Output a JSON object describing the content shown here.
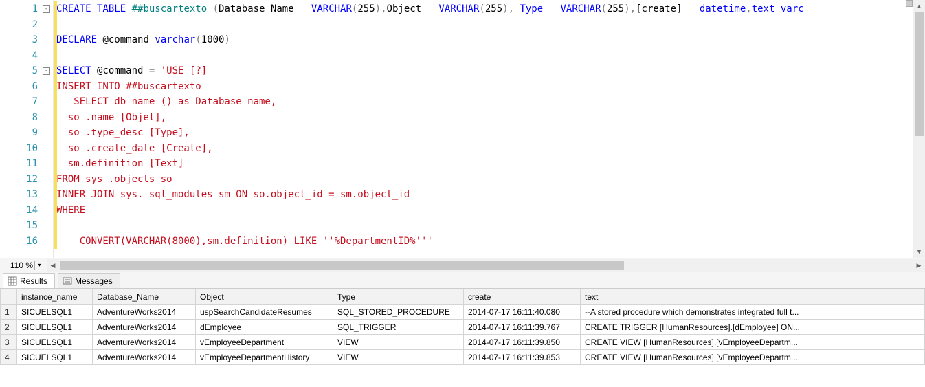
{
  "editor": {
    "zoom": "110 %",
    "lines": [
      {
        "num": 1,
        "fold": "-",
        "tokens": [
          {
            "t": "CREATE TABLE",
            "c": "tok-blue"
          },
          {
            "t": " ",
            "c": ""
          },
          {
            "t": "##buscartexto",
            "c": "tok-teal"
          },
          {
            "t": " ",
            "c": ""
          },
          {
            "t": "(",
            "c": "tok-gray"
          },
          {
            "t": "Database_Name   ",
            "c": "tok-black"
          },
          {
            "t": "VARCHAR",
            "c": "tok-blue"
          },
          {
            "t": "(",
            "c": "tok-gray"
          },
          {
            "t": "255",
            "c": "tok-black"
          },
          {
            "t": ")",
            "c": "tok-gray"
          },
          {
            "t": ",",
            "c": "tok-gray"
          },
          {
            "t": "Object   ",
            "c": "tok-black"
          },
          {
            "t": "VARCHAR",
            "c": "tok-blue"
          },
          {
            "t": "(",
            "c": "tok-gray"
          },
          {
            "t": "255",
            "c": "tok-black"
          },
          {
            "t": ")",
            "c": "tok-gray"
          },
          {
            "t": ",",
            "c": "tok-gray"
          },
          {
            "t": " ",
            "c": ""
          },
          {
            "t": "Type",
            "c": "tok-blue"
          },
          {
            "t": "   ",
            "c": ""
          },
          {
            "t": "VARCHAR",
            "c": "tok-blue"
          },
          {
            "t": "(",
            "c": "tok-gray"
          },
          {
            "t": "255",
            "c": "tok-black"
          },
          {
            "t": ")",
            "c": "tok-gray"
          },
          {
            "t": ",",
            "c": "tok-gray"
          },
          {
            "t": "[create]   ",
            "c": "tok-black"
          },
          {
            "t": "datetime",
            "c": "tok-blue"
          },
          {
            "t": ",",
            "c": "tok-gray"
          },
          {
            "t": "text",
            "c": "tok-blue"
          },
          {
            "t": " ",
            "c": ""
          },
          {
            "t": "varc",
            "c": "tok-blue"
          }
        ]
      },
      {
        "num": 2,
        "tokens": []
      },
      {
        "num": 3,
        "tokens": [
          {
            "t": "DECLARE",
            "c": "tok-blue"
          },
          {
            "t": " @command ",
            "c": "tok-black"
          },
          {
            "t": "varchar",
            "c": "tok-blue"
          },
          {
            "t": "(",
            "c": "tok-gray"
          },
          {
            "t": "1000",
            "c": "tok-black"
          },
          {
            "t": ")",
            "c": "tok-gray"
          }
        ]
      },
      {
        "num": 4,
        "tokens": []
      },
      {
        "num": 5,
        "fold": "-",
        "tokens": [
          {
            "t": "SELECT",
            "c": "tok-blue"
          },
          {
            "t": " @command ",
            "c": "tok-black"
          },
          {
            "t": "=",
            "c": "tok-gray"
          },
          {
            "t": " ",
            "c": ""
          },
          {
            "t": "'USE [?]",
            "c": "tok-red"
          }
        ]
      },
      {
        "num": 6,
        "tokens": [
          {
            "t": "INSERT INTO ##buscartexto",
            "c": "tok-red"
          }
        ]
      },
      {
        "num": 7,
        "tokens": [
          {
            "t": "   SELECT db_name () as Database_name,",
            "c": "tok-red"
          }
        ]
      },
      {
        "num": 8,
        "tokens": [
          {
            "t": "  so .name [Objet],",
            "c": "tok-red"
          }
        ]
      },
      {
        "num": 9,
        "tokens": [
          {
            "t": "  so .type_desc [Type],",
            "c": "tok-red"
          }
        ]
      },
      {
        "num": 10,
        "tokens": [
          {
            "t": "  so .create_date [Create],",
            "c": "tok-red"
          }
        ]
      },
      {
        "num": 11,
        "tokens": [
          {
            "t": "  sm.definition [Text]",
            "c": "tok-red"
          }
        ]
      },
      {
        "num": 12,
        "tokens": [
          {
            "t": "FROM sys .objects so",
            "c": "tok-red"
          }
        ]
      },
      {
        "num": 13,
        "tokens": [
          {
            "t": "INNER JOIN sys. sql_modules sm ON so.object_id = sm.object_id",
            "c": "tok-red"
          }
        ]
      },
      {
        "num": 14,
        "tokens": [
          {
            "t": "WHERE",
            "c": "tok-red"
          }
        ]
      },
      {
        "num": 15,
        "tokens": []
      },
      {
        "num": 16,
        "tokens": [
          {
            "t": "    CONVERT(VARCHAR(8000),sm.definition) LIKE ''%DepartmentID%'''",
            "c": "tok-red"
          }
        ]
      }
    ]
  },
  "tabs": {
    "results": "Results",
    "messages": "Messages"
  },
  "grid": {
    "headers": {
      "row": "",
      "instance": "instance_name",
      "database": "Database_Name",
      "object": "Object",
      "type": "Type",
      "create": "create",
      "text": "text"
    },
    "rows": [
      {
        "n": "1",
        "instance": "SICUELSQL1",
        "database": "AdventureWorks2014",
        "object": "uspSearchCandidateResumes",
        "type": "SQL_STORED_PROCEDURE",
        "create": "2014-07-17 16:11:40.080",
        "text": "--A stored procedure which demonstrates integrated full t..."
      },
      {
        "n": "2",
        "instance": "SICUELSQL1",
        "database": "AdventureWorks2014",
        "object": "dEmployee",
        "type": "SQL_TRIGGER",
        "create": "2014-07-17 16:11:39.767",
        "text": "CREATE TRIGGER [HumanResources].[dEmployee] ON..."
      },
      {
        "n": "3",
        "instance": "SICUELSQL1",
        "database": "AdventureWorks2014",
        "object": "vEmployeeDepartment",
        "type": "VIEW",
        "create": "2014-07-17 16:11:39.850",
        "text": "CREATE VIEW [HumanResources].[vEmployeeDepartm..."
      },
      {
        "n": "4",
        "instance": "SICUELSQL1",
        "database": "AdventureWorks2014",
        "object": "vEmployeeDepartmentHistory",
        "type": "VIEW",
        "create": "2014-07-17 16:11:39.853",
        "text": "CREATE VIEW [HumanResources].[vEmployeeDepartm..."
      }
    ]
  }
}
